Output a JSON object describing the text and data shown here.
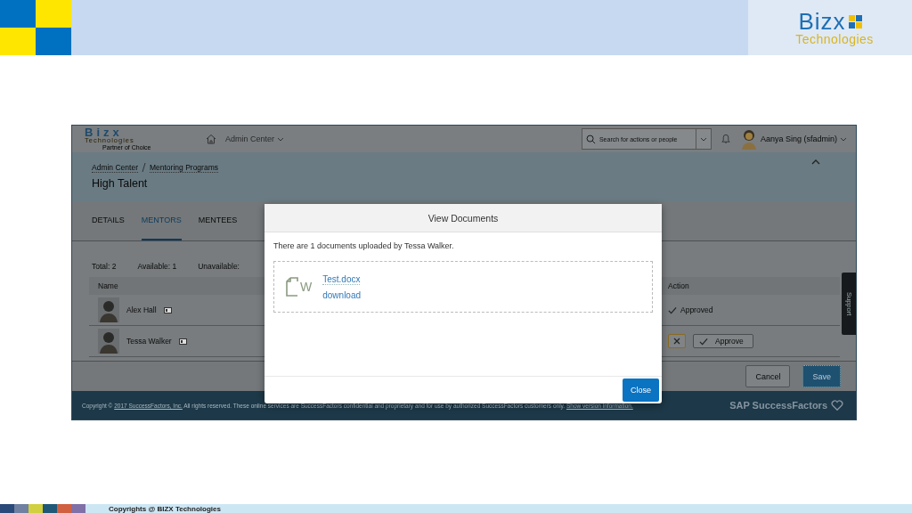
{
  "slide": {
    "logo": {
      "name": "Bizx",
      "tagline": "Technologies"
    },
    "footer": "Copyrights @ BIZX Technologies"
  },
  "app": {
    "logo": {
      "name": "Bizx",
      "tagline": "Technologies",
      "motto": "Partner of Choice"
    },
    "nav_menu": "Admin Center",
    "search": {
      "placeholder": "Search for actions or people"
    },
    "user": "Aanya Sing (sfadmin)",
    "breadcrumb": [
      "Admin Center",
      "Mentoring Programs"
    ],
    "title": "High Talent",
    "tabs": [
      {
        "label": "DETAILS",
        "selected": false
      },
      {
        "label": "MENTORS",
        "selected": true
      },
      {
        "label": "MENTEES",
        "selected": false
      }
    ],
    "stats": [
      {
        "label": "Total:",
        "value": "2"
      },
      {
        "label": "Available:",
        "value": "1"
      },
      {
        "label": "Unavailable:"
      }
    ],
    "table": {
      "columns": [
        "Name",
        "Action"
      ],
      "rows": [
        {
          "name": "Alex Hall",
          "action": {
            "kind": "status",
            "label": "Approved"
          }
        },
        {
          "name": "Tessa Walker",
          "action": {
            "kind": "buttons",
            "label": "Approve"
          }
        }
      ]
    },
    "buttons": [
      {
        "label": "Cancel",
        "kind": "secondary"
      },
      {
        "label": "Save",
        "kind": "primary"
      }
    ],
    "support_tab": "Support",
    "footer": {
      "copyright": "Copyright ©",
      "company_link": "2017 SuccessFactors, Inc.",
      "notice": "All rights reserved. These online services are SuccessFactors confidential and proprietary and for use by authorized SuccessFactors customers only.",
      "version_link": "Show version information.",
      "brand": "SAP SuccessFactors"
    }
  },
  "dialog": {
    "title": "View Documents",
    "message": "There are 1 documents uploaded by Tessa Walker.",
    "documents": [
      {
        "type_letter": "W",
        "file": "Test.docx",
        "link": "download"
      }
    ],
    "buttons": [
      "Close"
    ]
  }
}
